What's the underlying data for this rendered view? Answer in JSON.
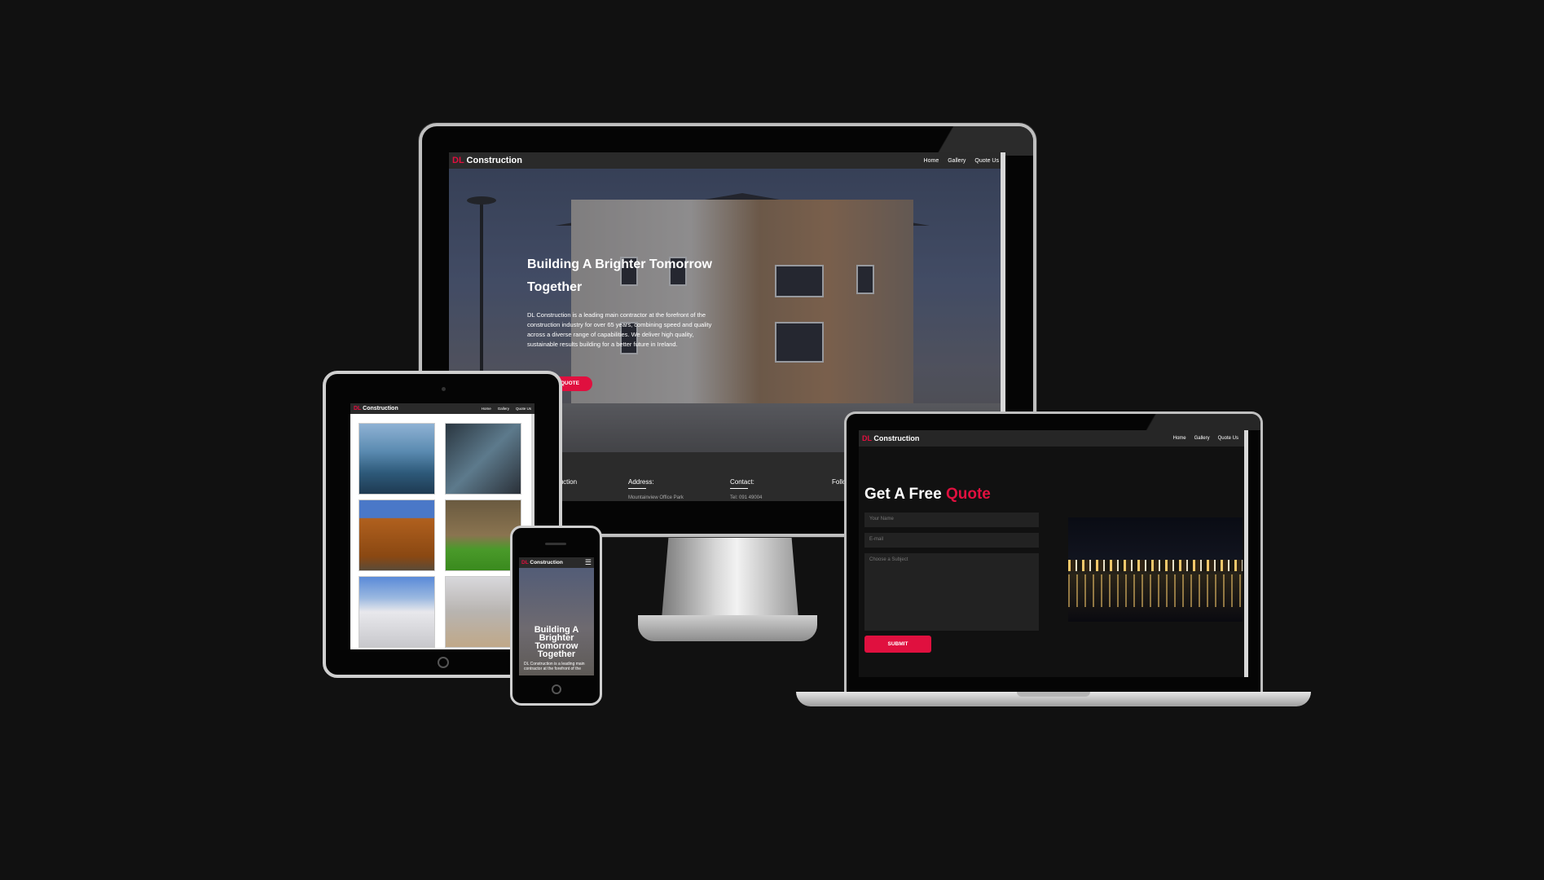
{
  "site": {
    "brand_prefix": "DL",
    "brand_name": "Construction",
    "nav": [
      "Home",
      "Gallery",
      "Quote Us"
    ]
  },
  "monitor": {
    "hero_title": "Building A Brighter Tomorrow Together",
    "hero_text": "DL Construction is a leading main contractor at the forefront of the construction industry for over 65 years, combining speed and quality across a diverse range of capabilities. We deliver high quality, sustainable results building for a better future in Ireland.",
    "cta_label": "GET A QUOTE",
    "footer": {
      "col1": "DL Construction",
      "col2_title": "Address:",
      "col2_line": "Mountainview Office Park",
      "col3_title": "Contact:",
      "col3_line": "Tel: 091 49004",
      "col4_title": "Follow"
    }
  },
  "phone": {
    "hero_title": "Building A Brighter Tomorrow Together",
    "hero_text": "DL Construction is a leading main contractor at the forefront of the"
  },
  "laptop": {
    "heading_main": "Get A Free",
    "heading_accent": "Quote",
    "name_placeholder": "Your Name",
    "email_placeholder": "E-mail",
    "subject_placeholder": "Choose a Subject",
    "submit_label": "SUBMIT"
  },
  "colors": {
    "accent": "#e0103f",
    "background": "#111111",
    "navbar": "#2a2a2a"
  }
}
